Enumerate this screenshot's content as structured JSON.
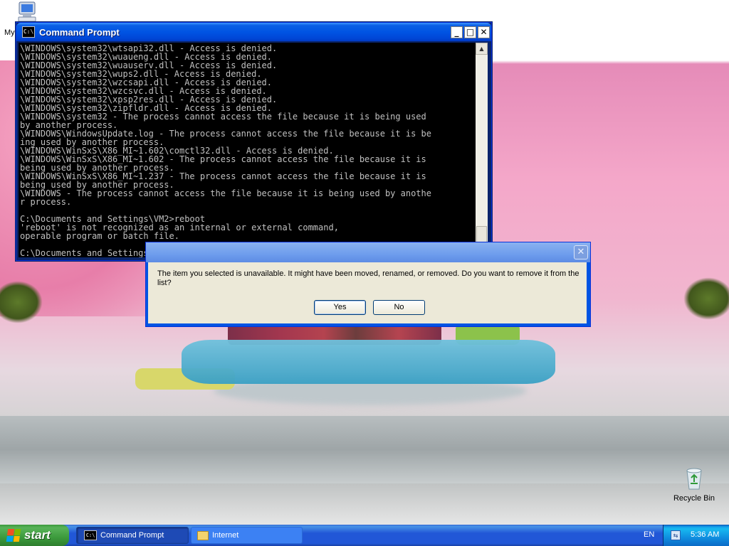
{
  "desktop": {
    "icons": {
      "my_computer_label": "My",
      "recycle_bin_label": "Recycle Bin"
    }
  },
  "cmd_window": {
    "title": "Command Prompt",
    "icon_text": "C:\\",
    "minimize": "_",
    "maximize": "□",
    "close": "✕",
    "lines": [
      "\\WINDOWS\\system32\\wtsapi32.dll - Access is denied.",
      "\\WINDOWS\\system32\\wuaueng.dll - Access is denied.",
      "\\WINDOWS\\system32\\wuauserv.dll - Access is denied.",
      "\\WINDOWS\\system32\\wups2.dll - Access is denied.",
      "\\WINDOWS\\system32\\wzcsapi.dll - Access is denied.",
      "\\WINDOWS\\system32\\wzcsvc.dll - Access is denied.",
      "\\WINDOWS\\system32\\xpsp2res.dll - Access is denied.",
      "\\WINDOWS\\system32\\zipfldr.dll - Access is denied.",
      "\\WINDOWS\\system32 - The process cannot access the file because it is being used",
      "by another process.",
      "\\WINDOWS\\WindowsUpdate.log - The process cannot access the file because it is be",
      "ing used by another process.",
      "\\WINDOWS\\WinSxS\\X86_MI~1.602\\comctl32.dll - Access is denied.",
      "\\WINDOWS\\WinSxS\\X86_MI~1.602 - The process cannot access the file because it is",
      "being used by another process.",
      "\\WINDOWS\\WinSxS\\X86_MI~1.237 - The process cannot access the file because it is",
      "being used by another process.",
      "\\WINDOWS - The process cannot access the file because it is being used by anothe",
      "r process.",
      "",
      "C:\\Documents and Settings\\VM2>reboot",
      "'reboot' is not recognized as an internal or external command,",
      "operable program or batch file.",
      "",
      "C:\\Documents and Settings\\VM2>_"
    ],
    "scroll_up": "▲",
    "scroll_down": "▼"
  },
  "dialog": {
    "close": "✕",
    "message": "The item you selected is unavailable.  It might have been moved, renamed, or removed.  Do you want to remove it from the list?",
    "yes_label": "Yes",
    "no_label": "No"
  },
  "taskbar": {
    "start_label": "start",
    "items": [
      {
        "label": "Command Prompt",
        "icon": "cmd-icon",
        "active": true
      },
      {
        "label": "Internet",
        "icon": "folder-icon",
        "active": false
      }
    ],
    "language": "EN",
    "tray_icon": "network-icon",
    "clock": "5:36 AM"
  }
}
